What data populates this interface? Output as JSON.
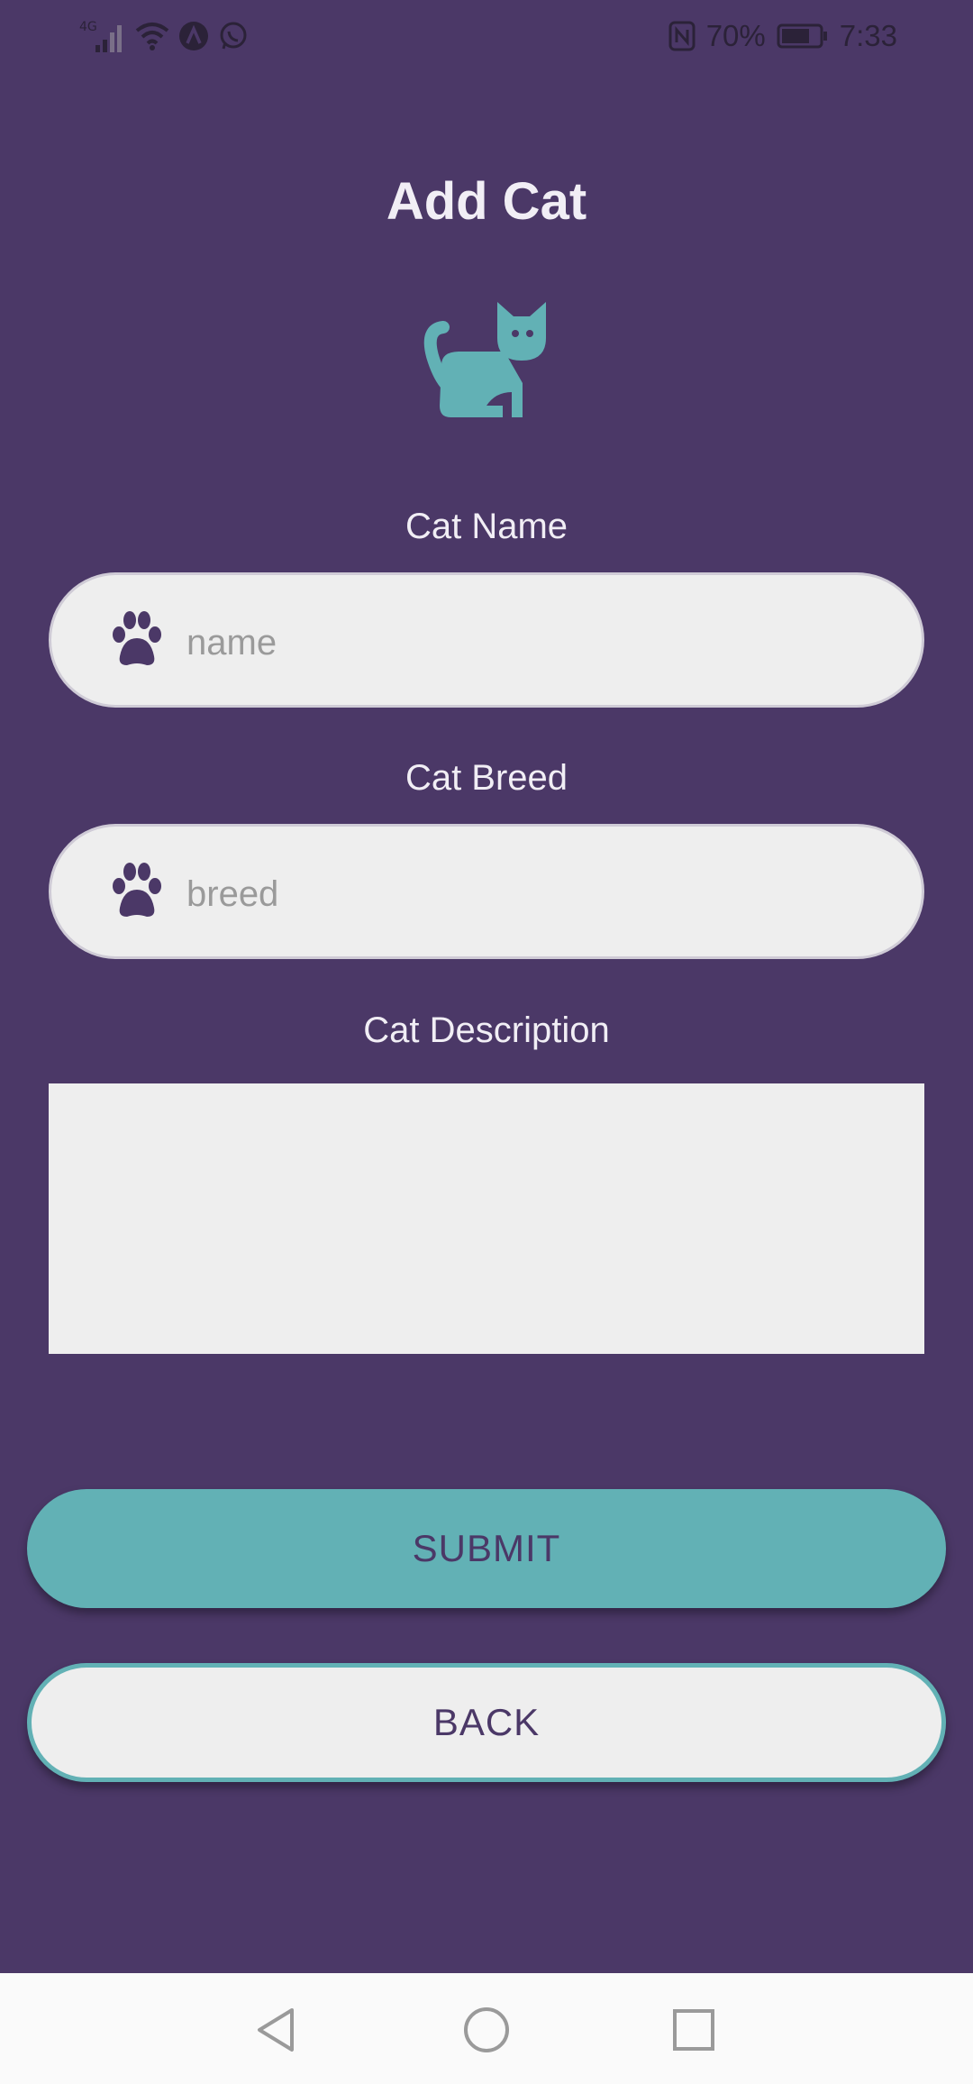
{
  "status_bar": {
    "network": "4G",
    "battery_percent": "70%",
    "time": "7:33",
    "icons": [
      "signal-icon",
      "wifi-icon",
      "app-a-icon",
      "whatsapp-icon",
      "nfc-icon",
      "battery-icon"
    ]
  },
  "page": {
    "title": "Add Cat",
    "logo_icon": "cat-icon"
  },
  "form": {
    "name_label": "Cat Name",
    "name_placeholder": "name",
    "name_value": "",
    "breed_label": "Cat Breed",
    "breed_placeholder": "breed",
    "breed_value": "",
    "description_label": "Cat Description",
    "description_value": "",
    "field_icon": "paw-icon"
  },
  "buttons": {
    "submit_label": "SUBMIT",
    "back_label": "BACK"
  },
  "nav": {
    "items": [
      "back-icon",
      "home-icon",
      "recents-icon"
    ]
  },
  "colors": {
    "background": "#4b3867",
    "accent": "#62b1b5",
    "field": "#eeeeee"
  }
}
